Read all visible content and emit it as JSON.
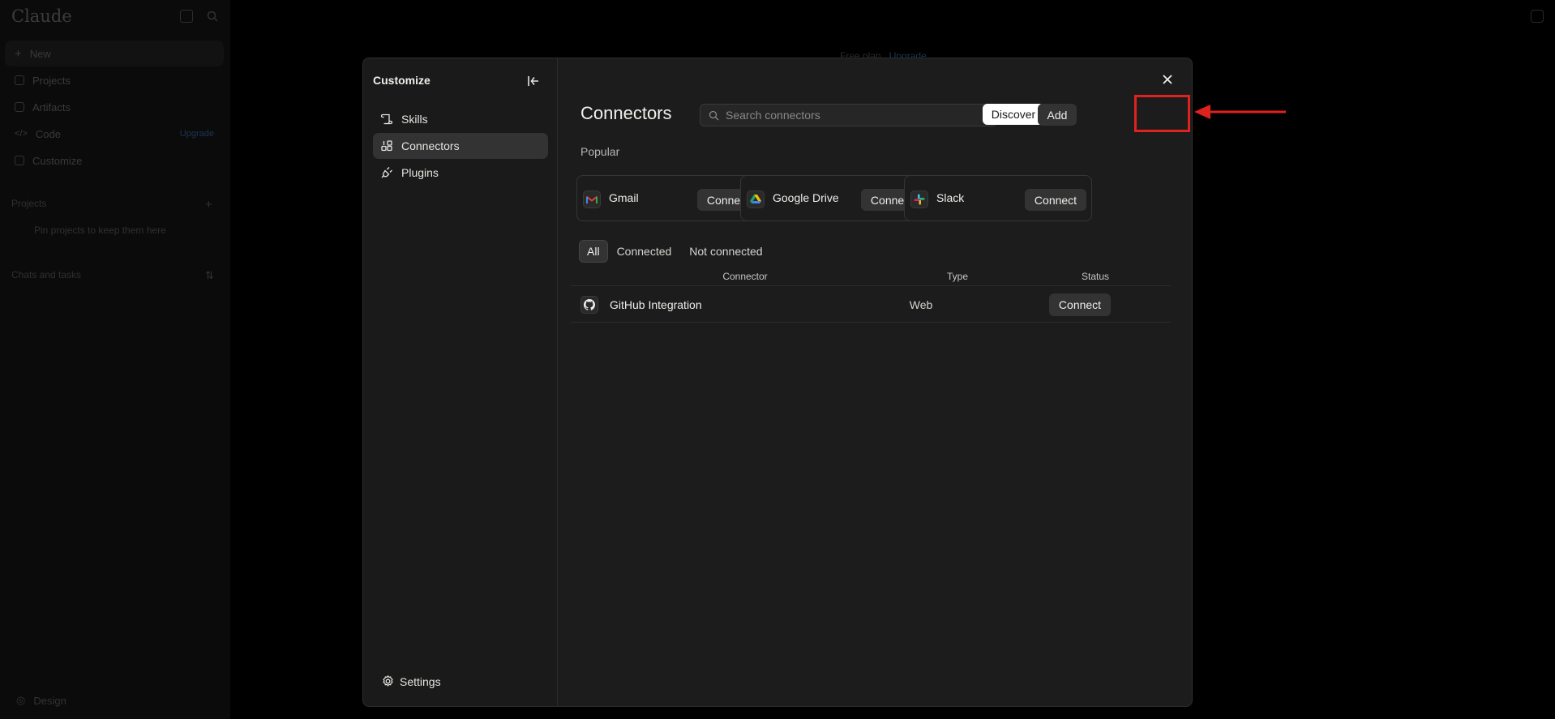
{
  "background_app": {
    "logo": "Claude",
    "nav": [
      {
        "label": "New"
      },
      {
        "label": "Projects"
      },
      {
        "label": "Artifacts"
      },
      {
        "label": "Code",
        "badge": "Upgrade"
      },
      {
        "label": "Customize"
      }
    ],
    "projects_section": "Projects",
    "projects_hint": "Pin projects to keep them here",
    "chats_section": "Chats and tasks",
    "bottom_item": "Design",
    "plan_text": "Free plan",
    "plan_link": "Upgrade"
  },
  "modal": {
    "sidebar": {
      "title": "Customize",
      "items": [
        {
          "label": "Skills",
          "icon": "skills-icon"
        },
        {
          "label": "Connectors",
          "icon": "connectors-icon",
          "active": true
        },
        {
          "label": "Plugins",
          "icon": "plugins-icon"
        }
      ],
      "settings_label": "Settings"
    },
    "main": {
      "title": "Connectors",
      "search_placeholder": "Search connectors",
      "discover_label": "Discover",
      "add_label": "Add",
      "popular_label": "Popular",
      "popular": [
        {
          "name": "Gmail",
          "icon": "gmail-icon",
          "action": "Connect"
        },
        {
          "name": "Google Drive",
          "icon": "google-drive-icon",
          "action": "Connect"
        },
        {
          "name": "Slack",
          "icon": "slack-icon",
          "action": "Connect"
        }
      ],
      "filters": [
        "All",
        "Connected",
        "Not connected"
      ],
      "active_filter": "All",
      "table": {
        "columns": [
          "Connector",
          "Type",
          "Status"
        ],
        "rows": [
          {
            "name": "GitHub Integration",
            "icon": "github-icon",
            "type": "Web",
            "status": "Connect"
          }
        ]
      }
    }
  },
  "annotation": {
    "highlight_color": "#e0221f",
    "target": "add-button"
  }
}
